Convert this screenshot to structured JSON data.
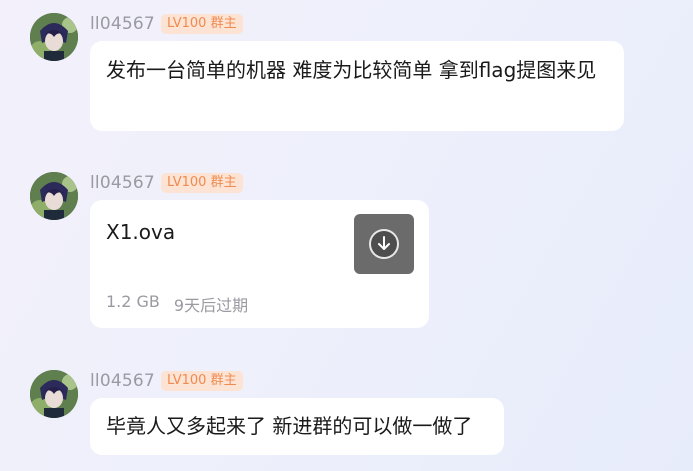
{
  "messages": [
    {
      "sender": "ll04567",
      "badge": "LV100 群主",
      "text": "发布一台简单的机器 难度为比较简单 拿到flag提图来见"
    },
    {
      "sender": "ll04567",
      "badge": "LV100 群主",
      "file": {
        "name": "X1.ova",
        "size": "1.2 GB",
        "expiry": "9天后过期",
        "icon": "download-icon"
      }
    },
    {
      "sender": "ll04567",
      "badge": "LV100 群主",
      "text": "毕竟人又多起来了 新进群的可以做一做了"
    }
  ],
  "colors": {
    "badge_text": "#f08b4f",
    "badge_bg": "#fde3d4",
    "sender": "#9a9aa2",
    "bubble": "#ffffff"
  }
}
